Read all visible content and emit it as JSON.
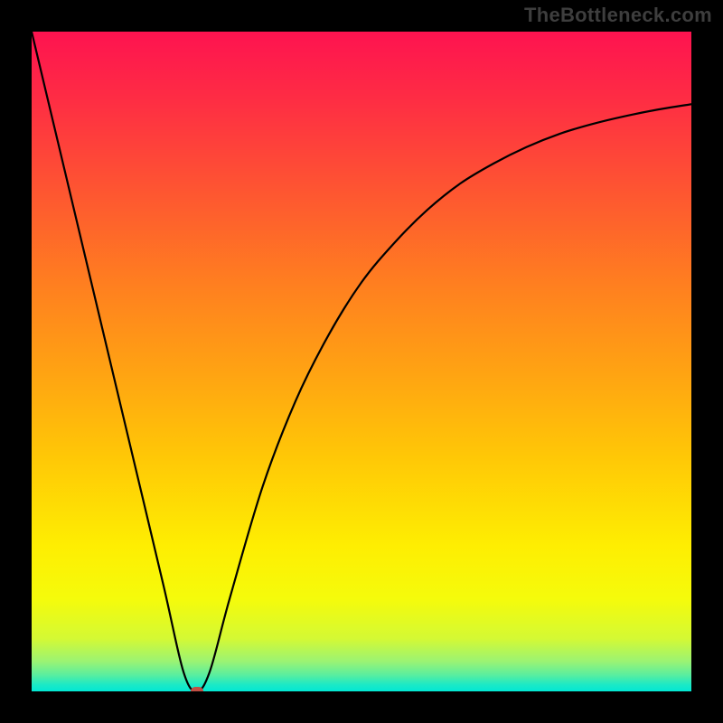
{
  "watermark": {
    "text": "TheBottleneck.com"
  },
  "chart_data": {
    "type": "line",
    "title": "",
    "xlabel": "",
    "ylabel": "",
    "xlim": [
      0,
      100
    ],
    "ylim": [
      0,
      100
    ],
    "background_gradient_meaning": "red=high bottleneck, green=low bottleneck",
    "series": [
      {
        "name": "bottleneck-curve",
        "x": [
          0,
          5,
          10,
          15,
          20,
          23,
          25,
          27,
          30,
          35,
          40,
          45,
          50,
          55,
          60,
          65,
          70,
          75,
          80,
          85,
          90,
          95,
          100
        ],
        "y": [
          100,
          79,
          58,
          37,
          16,
          3,
          0,
          3,
          14,
          31,
          44,
          54,
          62,
          68,
          73,
          77,
          80,
          82.5,
          84.5,
          86,
          87.2,
          88.2,
          89
        ]
      }
    ],
    "marker": {
      "name": "current-config",
      "x": 25,
      "y": 0,
      "color": "#c24e44"
    }
  }
}
